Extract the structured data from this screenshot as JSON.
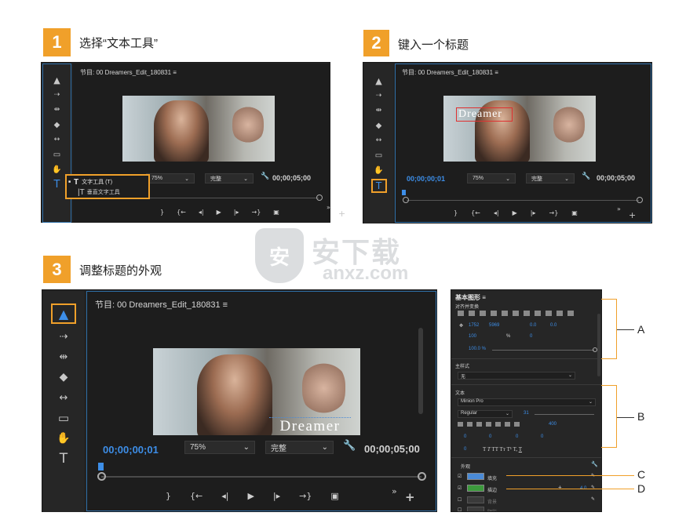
{
  "steps": [
    {
      "number": "1",
      "title": "选择“文本工具”"
    },
    {
      "number": "2",
      "title": "键入一个标题"
    },
    {
      "number": "3",
      "title": "调整标题的外观"
    }
  ],
  "program_monitor": {
    "title": "节目: 00 Dreamers_Edit_180831",
    "menu_icon": "≡",
    "timecode_current": "00;00;00;01",
    "timecode_duration": "00;00;05;00",
    "zoom_value": "75%",
    "quality_value": "完整"
  },
  "tool_flyout": {
    "items": [
      "文字工具 (T)",
      "垂直文字工具"
    ]
  },
  "title_text": "Dreamer",
  "watermark": {
    "text_cn": "安下载",
    "text_en": "anxz.com"
  },
  "essential_graphics": {
    "title": "基本图形",
    "align_label": "对齐并变换",
    "pos_x": "1752",
    "pos_y": "5969",
    "rotation": "0.0",
    "anchor_val": "0.0",
    "scale_val": "100",
    "scale_percent": "%",
    "rot2_val": "0",
    "opacity_val": "100.0 %",
    "master_style_label": "主样式",
    "master_style_value": "无",
    "text_label": "文本",
    "font_family": "Minion Pro",
    "font_style": "Regular",
    "font_size": "31",
    "tracking_val": "400",
    "small_vals": [
      "0",
      "0",
      "0",
      "0",
      "0"
    ],
    "appearance_label": "外观",
    "fill_label": "填充",
    "stroke_label": "描边",
    "stroke_width": "4.0",
    "bg_label": "背景",
    "shadow_label": "阴影"
  },
  "callouts": [
    "A",
    "B",
    "C",
    "D"
  ],
  "colors": {
    "accent_orange": "#f0a02a",
    "timecode_blue": "#3d8ee8",
    "fill_blue": "#4a8ad6",
    "stroke_green": "#3c9a3c"
  }
}
